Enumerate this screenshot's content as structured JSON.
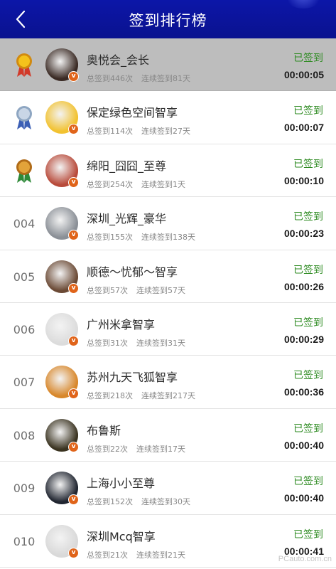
{
  "header": {
    "title": "签到排行榜",
    "back": "back-chevron-icon"
  },
  "labels": {
    "total_prefix": "总签到",
    "streak_prefix": "连续签到",
    "times_unit": "次",
    "days_unit": "天"
  },
  "colors": {
    "header_bg": "#0a128f",
    "signed_green": "#2e8b22",
    "badge_orange": "#e0641a",
    "highlight_row": "#bdbdbd"
  },
  "rows": [
    {
      "rank": "",
      "medal": "gold",
      "name": "奥悦会_会长",
      "total": "总签到446次",
      "streak": "连续签到81天",
      "status": "已签到",
      "time": "00:00:05",
      "avatar_color": "#3a2a24"
    },
    {
      "rank": "",
      "medal": "silver",
      "name": "保定绿色空间智享",
      "total": "总签到114次",
      "streak": "连续签到27天",
      "status": "已签到",
      "time": "00:00:07",
      "avatar_color": "#f2c230"
    },
    {
      "rank": "",
      "medal": "bronze",
      "name": "绵阳_囧囧_至尊",
      "total": "总签到254次",
      "streak": "连续签到1天",
      "status": "已签到",
      "time": "00:00:10",
      "avatar_color": "#b84a3a"
    },
    {
      "rank": "004",
      "medal": "",
      "name": "深圳_光辉_豪华",
      "total": "总签到155次",
      "streak": "连续签到138天",
      "status": "已签到",
      "time": "00:00:23",
      "avatar_color": "#8a8f96"
    },
    {
      "rank": "005",
      "medal": "",
      "name": "顺德～忧郁～智享",
      "total": "总签到57次",
      "streak": "连续签到57天",
      "status": "已签到",
      "time": "00:00:26",
      "avatar_color": "#6b4a35"
    },
    {
      "rank": "006",
      "medal": "",
      "name": "广州米拿智享",
      "total": "总签到31次",
      "streak": "连续签到31天",
      "status": "已签到",
      "time": "00:00:29",
      "avatar_color": "#dcdcdc"
    },
    {
      "rank": "007",
      "medal": "",
      "name": "苏州九天飞狐智享",
      "total": "总签到218次",
      "streak": "连续签到217天",
      "status": "已签到",
      "time": "00:00:36",
      "avatar_color": "#d8872a"
    },
    {
      "rank": "008",
      "medal": "",
      "name": "布鲁斯",
      "total": "总签到22次",
      "streak": "连续签到17天",
      "status": "已签到",
      "time": "00:00:40",
      "avatar_color": "#3a3320"
    },
    {
      "rank": "009",
      "medal": "",
      "name": "上海小小至尊",
      "total": "总签到152次",
      "streak": "连续签到30天",
      "status": "已签到",
      "time": "00:00:40",
      "avatar_color": "#202530"
    },
    {
      "rank": "010",
      "medal": "",
      "name": "深圳Mcq智享",
      "total": "总签到21次",
      "streak": "连续签到21天",
      "status": "已签到",
      "time": "00:00:41",
      "avatar_color": "#d9d9d9"
    }
  ],
  "watermark": "PCauto.com.cn"
}
